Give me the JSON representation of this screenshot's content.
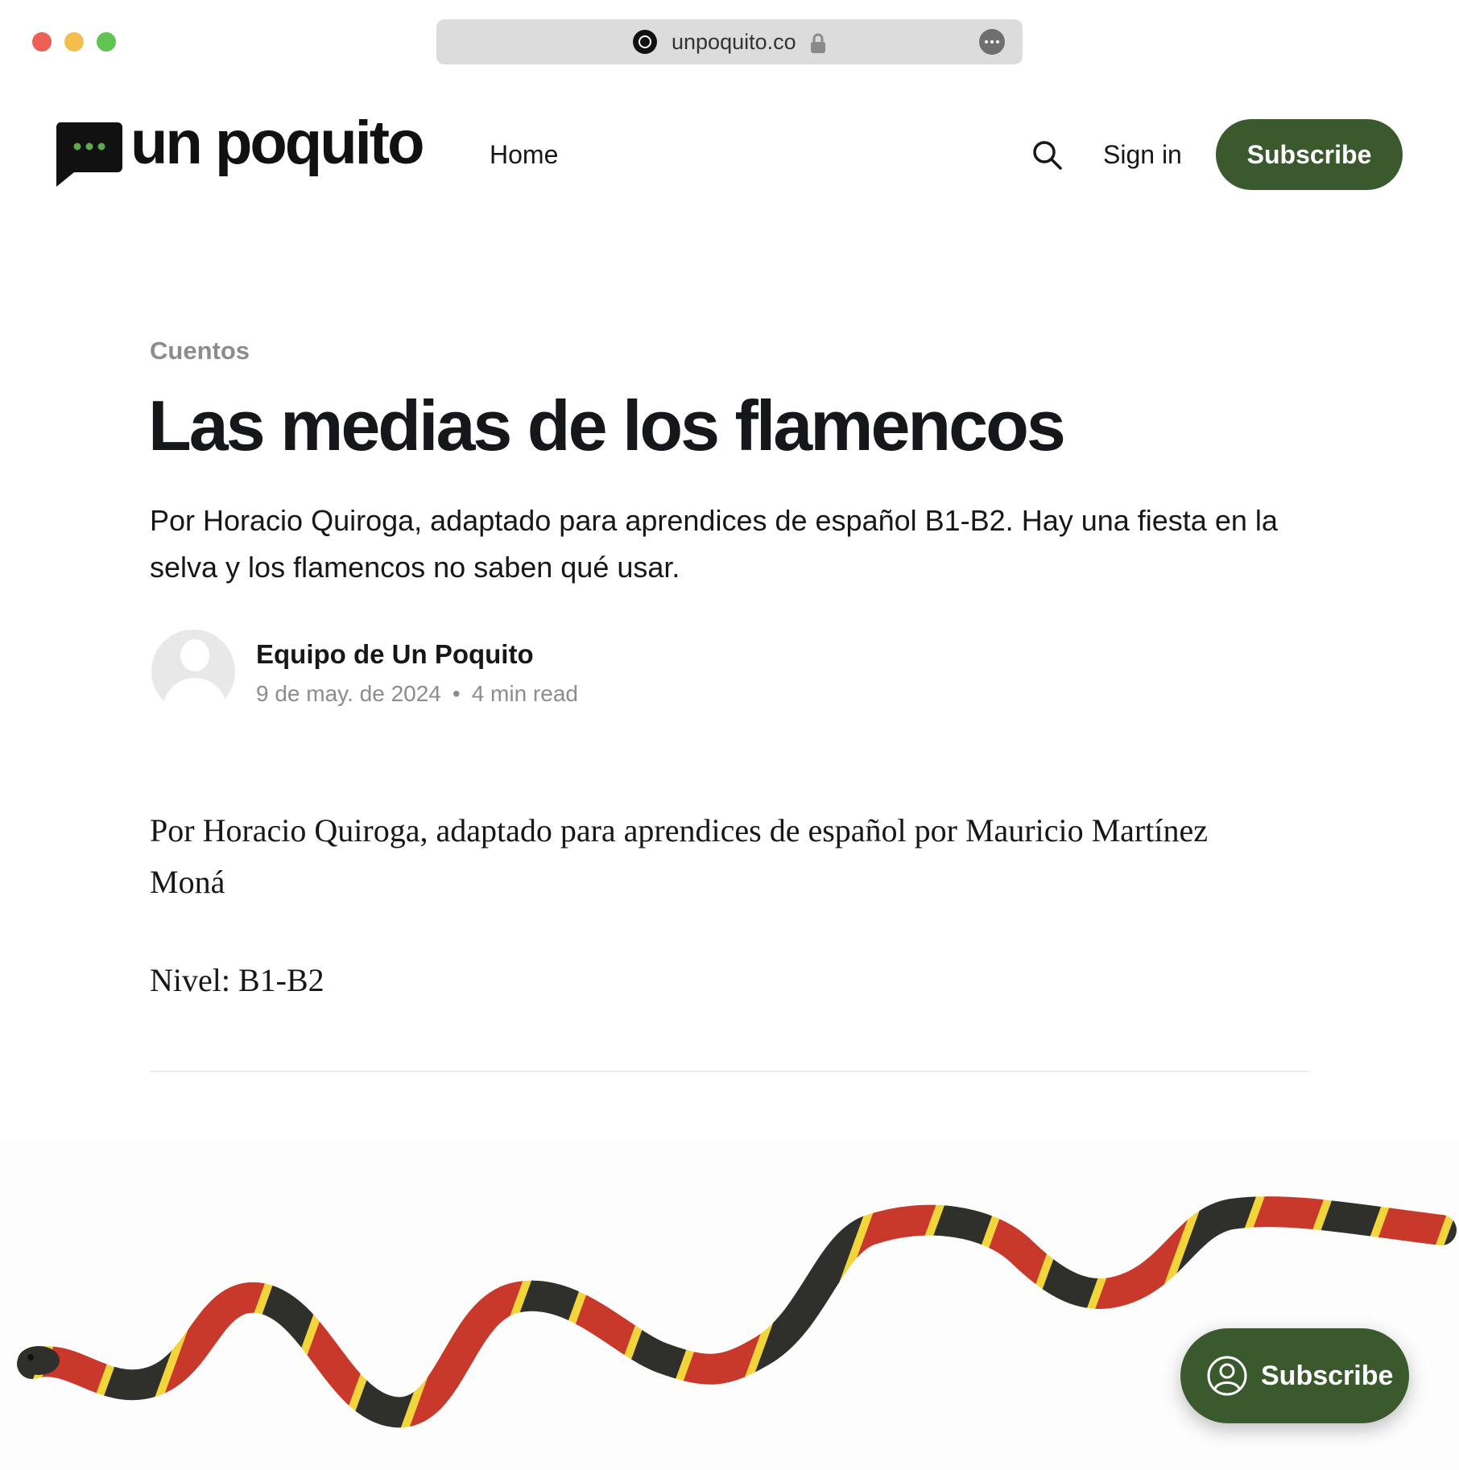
{
  "browser": {
    "url": "unpoquito.co",
    "traffic_colors": {
      "close": "#ec5f57",
      "minimize": "#f4bd4f",
      "zoom": "#5fc453"
    }
  },
  "header": {
    "logo_text": "un poquito",
    "nav": {
      "home_label": "Home"
    },
    "signin_label": "Sign in",
    "subscribe_label": "Subscribe",
    "accent_color": "#3a5a2e"
  },
  "article": {
    "tag": "Cuentos",
    "title": "Las medias de los flamencos",
    "excerpt": "Por Horacio Quiroga, adaptado para aprendices de español B1-B2. Hay una fiesta en la selva y los flamencos no saben qué usar.",
    "author": {
      "name": "Equipo de Un Poquito",
      "date": "9 de may. de 2024",
      "separator": "•",
      "read_time": "4 min read"
    },
    "body": {
      "paragraph_1": "Por Horacio Quiroga, adaptado para aprendices de español por Mauricio Martínez Moná",
      "paragraph_2": "Nivel: B1-B2"
    },
    "feature_image": "coral-snake-photo"
  },
  "floating_button": {
    "label": "Subscribe",
    "icon": "user-circle-icon"
  }
}
